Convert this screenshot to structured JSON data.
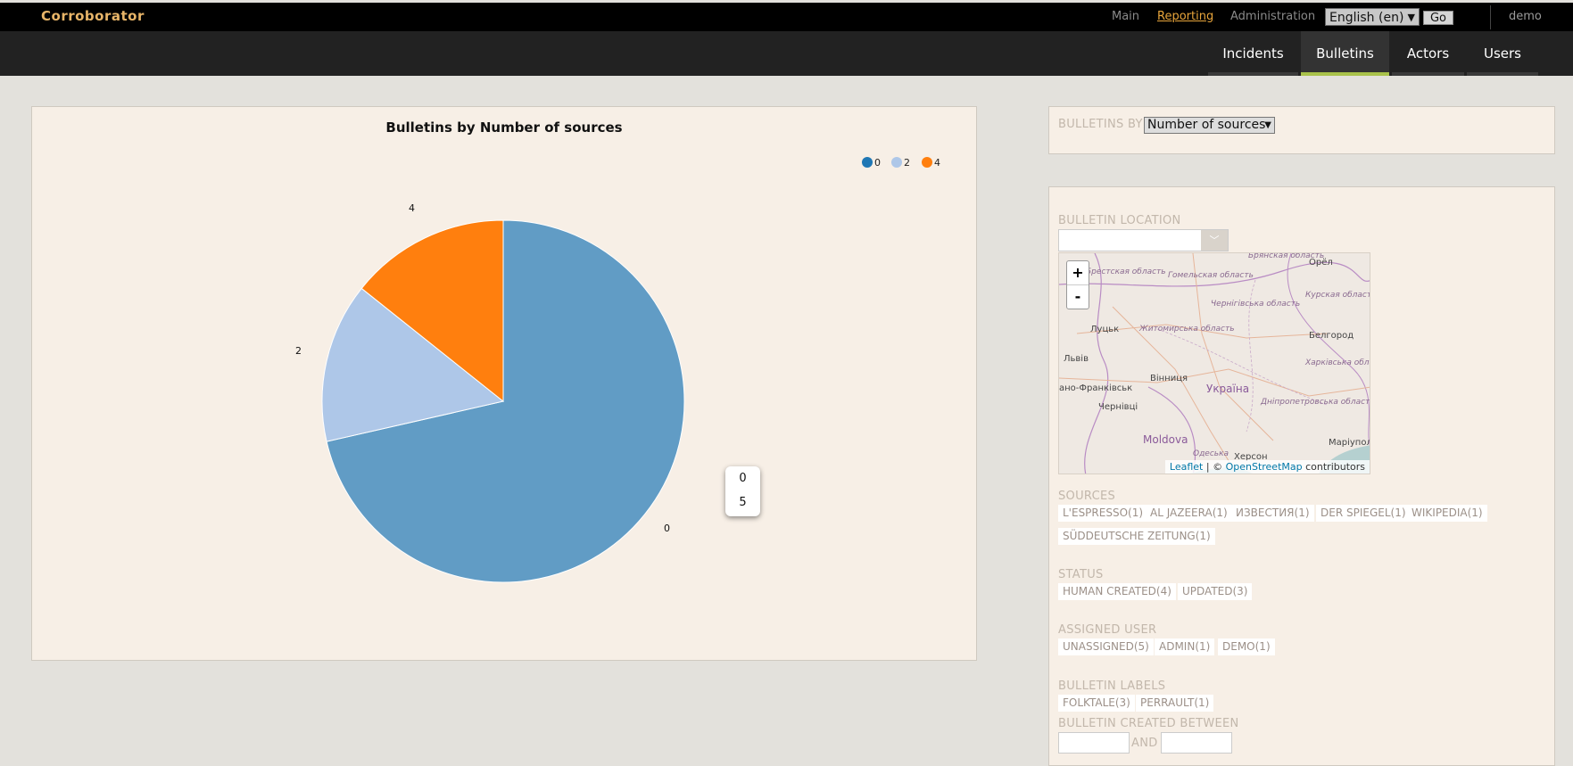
{
  "header": {
    "brand": "Corroborator",
    "nav": [
      "Main",
      "Reporting",
      "Administration"
    ],
    "language": "English (en)",
    "go_label": "Go",
    "user": "demo"
  },
  "tabs": [
    "Incidents",
    "Bulletins",
    "Actors",
    "Users"
  ],
  "chart_data": {
    "type": "pie",
    "title": "Bulletins by Number of sources",
    "categories": [
      "0",
      "2",
      "4"
    ],
    "values": [
      5,
      1,
      1
    ],
    "colors": [
      "#619cc5",
      "#aec7e8",
      "#ff7f0e"
    ],
    "legend_colors": [
      "#1f77b4",
      "#aec7e8",
      "#ff7f0e"
    ],
    "legend_position": "top-right",
    "tooltip": {
      "label": "0",
      "value": "5"
    }
  },
  "filter": {
    "bulletins_by_label": "BULLETINS BY",
    "bulletins_by_value": "Number of sources"
  },
  "sidebar": {
    "location_label": "BULLETIN LOCATION",
    "map": {
      "zoom_in": "+",
      "zoom_out": "-",
      "attribution_leaflet": "Leaflet",
      "attribution_sep": " | © ",
      "attribution_osm": "OpenStreetMap",
      "attribution_end": " contributors",
      "places": [
        "Брянская область",
        "Орёл",
        "Брестская область",
        "Гомельская область",
        "Курская область",
        "Чернігівська область",
        "Луцьк",
        "Житомирська область",
        "Белгород",
        "Львів",
        "Харківська область",
        "Вінниця",
        "Україна",
        "ано-Франківськ",
        "Дніпропетровська область",
        "Чернівці",
        "Moldova",
        "Маріуполь",
        "Одеська",
        "Херсон"
      ]
    },
    "sources_label": "SOURCES",
    "sources": [
      "L'ESPRESSO(1)",
      "AL JAZEERA(1)",
      "ИЗВЕСТИЯ(1)",
      "DER SPIEGEL(1)",
      "WIKIPEDIA(1)",
      "SÜDDEUTSCHE ZEITUNG(1)"
    ],
    "status_label": "STATUS",
    "status": [
      "HUMAN CREATED(4)",
      "UPDATED(3)"
    ],
    "assigned_label": "ASSIGNED USER",
    "assigned": [
      "UNASSIGNED(5)",
      "ADMIN(1)",
      "DEMO(1)"
    ],
    "labels_label": "BULLETIN LABELS",
    "labels": [
      "FOLKTALE(3)",
      "PERRAULT(1)"
    ],
    "created_label": "BULLETIN CREATED BETWEEN",
    "and_label": "AND"
  }
}
